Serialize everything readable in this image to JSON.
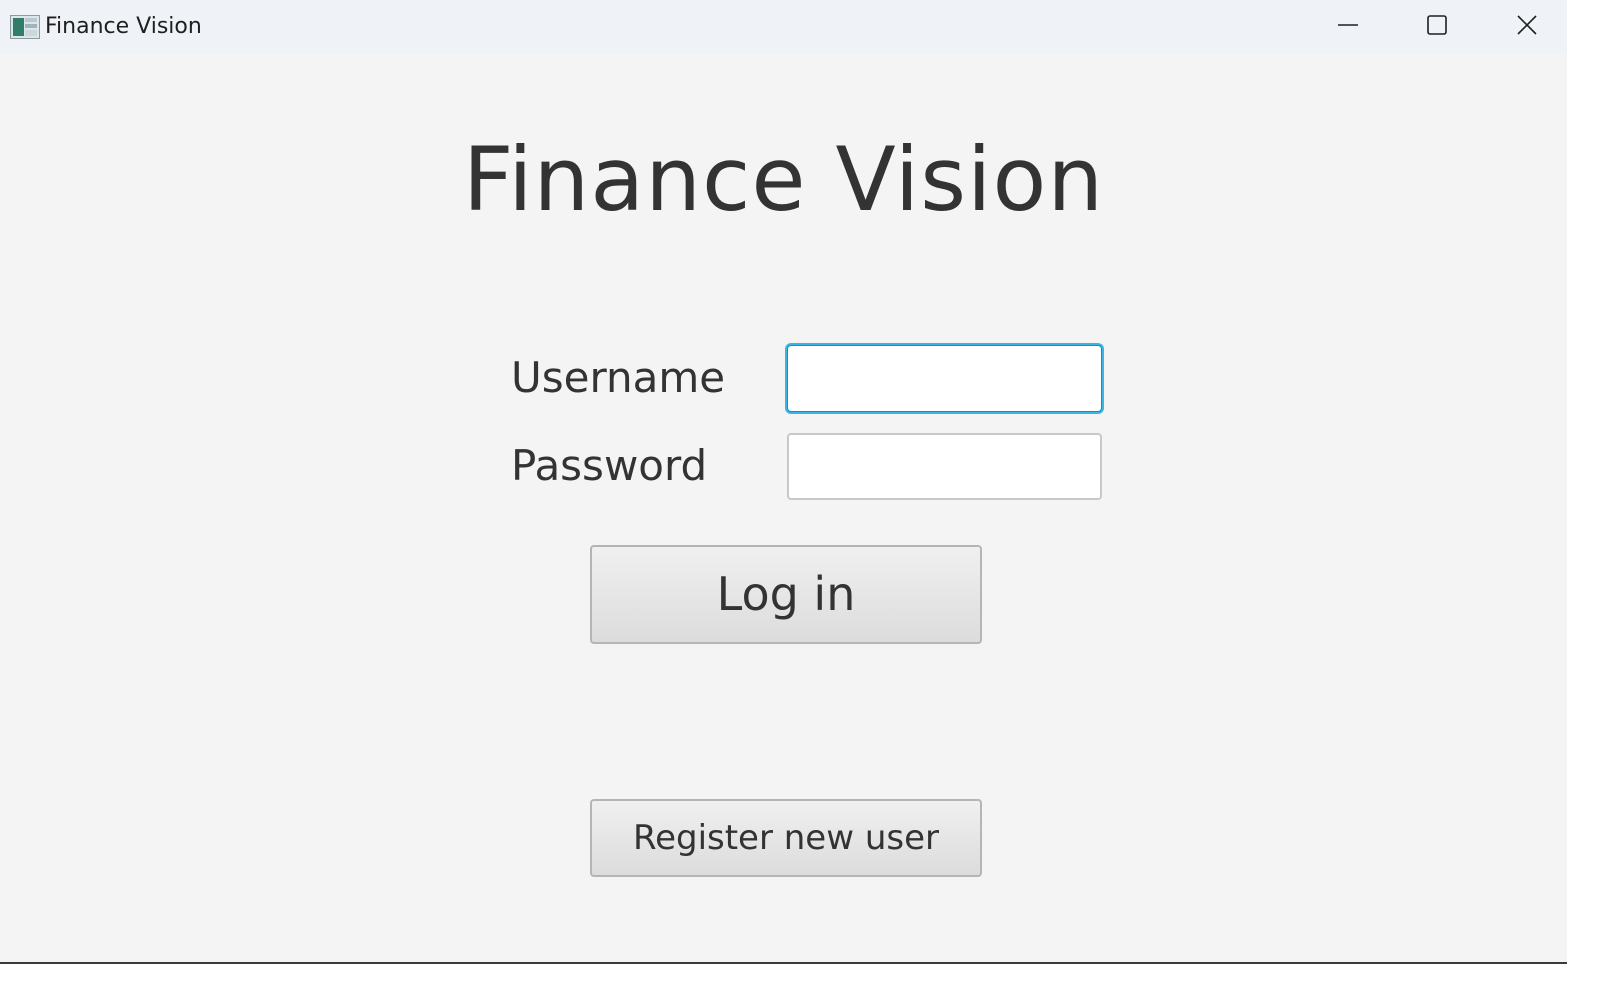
{
  "window": {
    "title": "Finance Vision",
    "icon": "finance-app-icon",
    "controls": {
      "minimize": "minimize-icon",
      "maximize": "maximize-icon",
      "close": "close-icon"
    }
  },
  "login": {
    "heading": "Finance Vision",
    "username_label": "Username",
    "username_value": "",
    "password_label": "Password",
    "password_value": "",
    "login_button": "Log in",
    "register_button": "Register new user"
  },
  "colors": {
    "background": "#f4f4f4",
    "titlebar": "#eff3f8",
    "focus_ring": "#38b6e8",
    "text": "#333333"
  }
}
